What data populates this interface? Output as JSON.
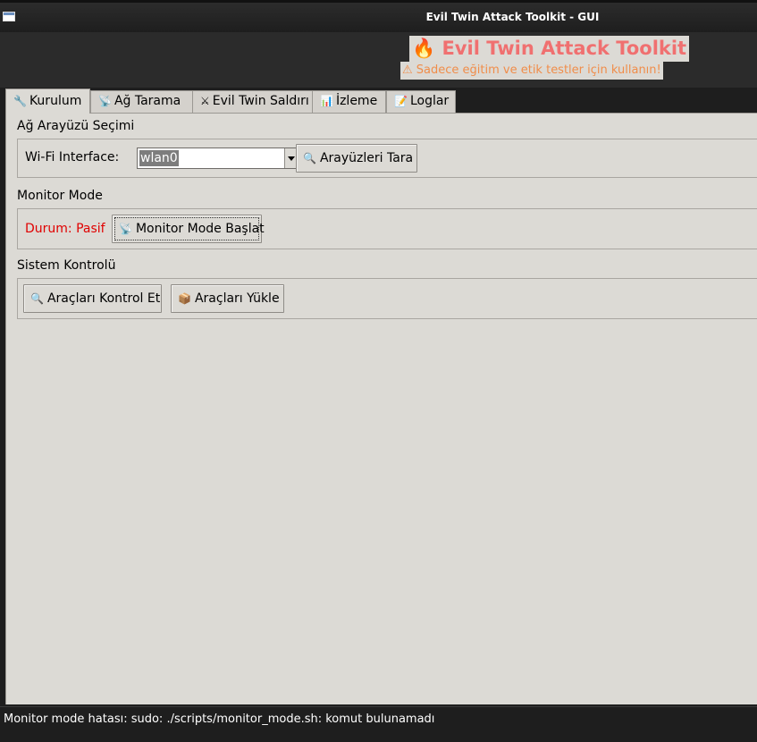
{
  "window": {
    "title": "Evil Twin Attack Toolkit - GUI",
    "icon": "window-icon"
  },
  "header": {
    "title": "🔥 Evil Twin Attack Toolkit",
    "subtitle": "⚠ Sadece eğitim ve etik testler için kullanın!",
    "title_color": "#f07070",
    "subtitle_color": "#f08d4a"
  },
  "tabs": [
    {
      "icon": "🔧",
      "label": "Kurulum",
      "active": true
    },
    {
      "icon": "📡",
      "label": "Ağ Tarama",
      "active": false
    },
    {
      "icon": "⚔",
      "label": "Evil Twin Saldırı",
      "active": false
    },
    {
      "icon": "📊",
      "label": "İzleme",
      "active": false
    },
    {
      "icon": "📝",
      "label": "Loglar",
      "active": false
    }
  ],
  "sections": {
    "interface": {
      "title": "Ağ Arayüzü Seçimi",
      "field_label": "Wi-Fi Interface:",
      "selected_value": "wlan0",
      "scan_button": {
        "icon": "🔍",
        "label": "Arayüzleri Tara"
      }
    },
    "monitor": {
      "title": "Monitor Mode",
      "status": "Durum: Pasif",
      "status_color": "#e00000",
      "start_button": {
        "icon": "📡",
        "label": "Monitor Mode Başlat"
      }
    },
    "system": {
      "title": "Sistem Kontrolü",
      "check_button": {
        "icon": "🔍",
        "label": "Araçları Kontrol Et"
      },
      "install_button": {
        "icon": "📦",
        "label": "Araçları Yükle"
      }
    }
  },
  "statusbar": {
    "message": "Monitor mode hatası: sudo: ./scripts/monitor_mode.sh: komut bulunamadı"
  }
}
